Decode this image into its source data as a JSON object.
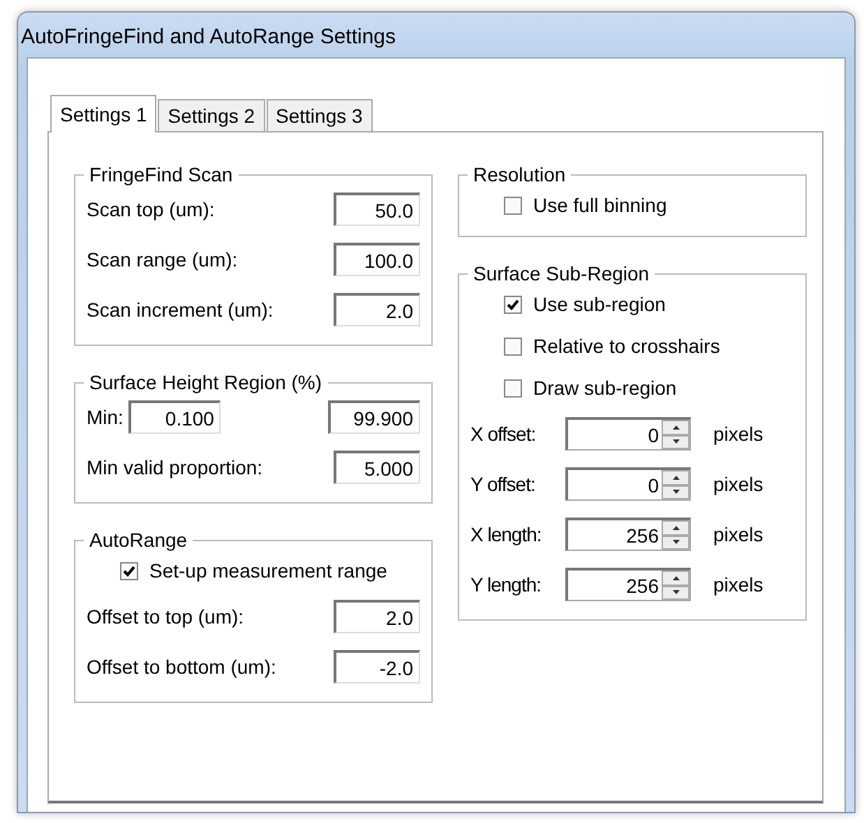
{
  "window": {
    "title": "AutoFringeFind and AutoRange Settings"
  },
  "tabs": [
    {
      "label": "Settings 1",
      "selected": true
    },
    {
      "label": "Settings 2",
      "selected": false
    },
    {
      "label": "Settings 3",
      "selected": false
    }
  ],
  "left_groups": [
    {
      "title": "FringeFind Scan",
      "rows": [
        {
          "kind": "field",
          "label": "Scan top (um):",
          "value": "50.0"
        },
        {
          "kind": "field",
          "label": "Scan range (um):",
          "value": "100.0"
        },
        {
          "kind": "field",
          "label": "Scan increment (um):",
          "value": "2.0"
        }
      ]
    },
    {
      "title": "Surface Height Region (%)",
      "rows": [
        {
          "kind": "pair",
          "label": "Min:",
          "value": "0.100",
          "value_2": "99.900"
        },
        {
          "kind": "field",
          "label": "Min valid proportion:",
          "value": "5.000"
        }
      ]
    },
    {
      "title": "AutoRange",
      "rows": [
        {
          "kind": "checkbox",
          "label": "Set-up measurement range",
          "checked": true
        },
        {
          "kind": "field",
          "label": "Offset to top (um):",
          "value": "2.0"
        },
        {
          "kind": "field",
          "label": "Offset to bottom (um):",
          "value": "-2.0"
        }
      ]
    }
  ],
  "right_groups": [
    {
      "title": "Resolution",
      "rows": [
        {
          "kind": "checkbox",
          "label": "Use full binning",
          "checked": false
        }
      ]
    },
    {
      "title": "Surface Sub-Region",
      "rows": [
        {
          "kind": "checkbox",
          "label": "Use sub-region",
          "checked": true
        },
        {
          "kind": "checkbox",
          "label": "Relative to crosshairs",
          "checked": false
        },
        {
          "kind": "checkbox",
          "label": "Draw sub-region",
          "checked": false
        },
        {
          "kind": "spin",
          "label": "X offset:",
          "value": "0",
          "unit": "pixels"
        },
        {
          "kind": "spin",
          "label": "Y offset:",
          "value": "0",
          "unit": "pixels"
        },
        {
          "kind": "spin",
          "label": "X length:",
          "value": "256",
          "unit": "pixels"
        },
        {
          "kind": "spin",
          "label": "Y length:",
          "value": "256",
          "unit": "pixels"
        }
      ]
    }
  ]
}
